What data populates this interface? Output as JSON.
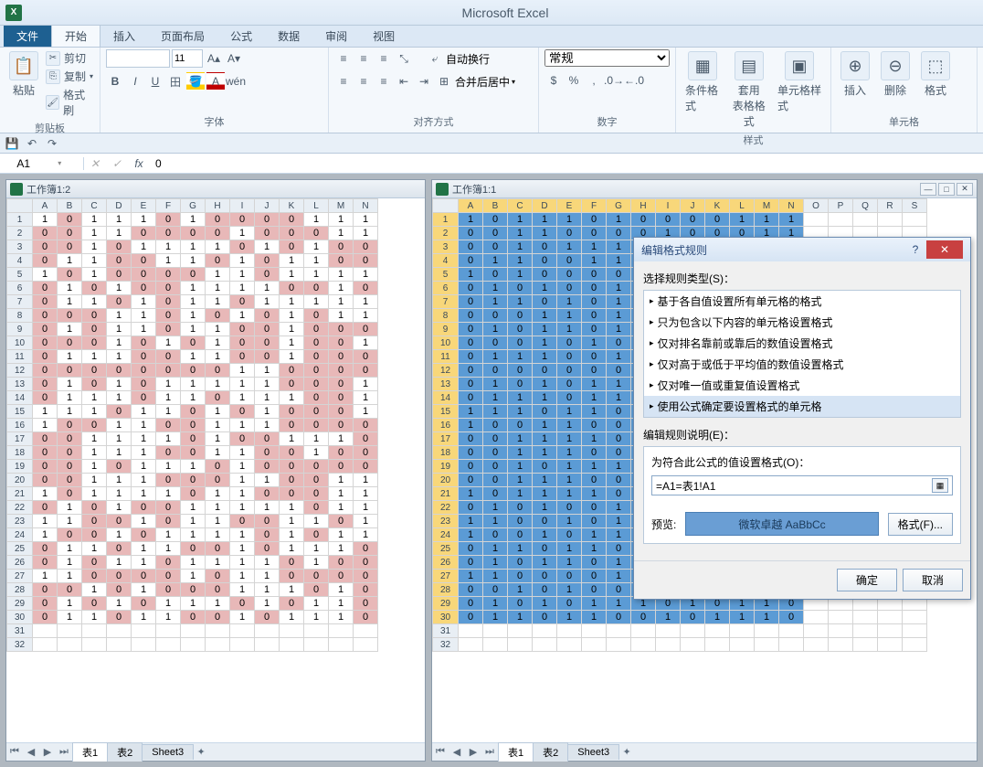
{
  "app": {
    "title": "Microsoft Excel",
    "icon_letter": "X"
  },
  "tabs": {
    "file": "文件",
    "home": "开始",
    "insert": "插入",
    "layout": "页面布局",
    "formulas": "公式",
    "data": "数据",
    "review": "审阅",
    "view": "视图"
  },
  "ribbon": {
    "clipboard": {
      "paste": "粘贴",
      "cut": "剪切",
      "copy": "复制",
      "brush": "格式刷",
      "label": "剪贴板"
    },
    "font": {
      "size": "11",
      "label": "字体"
    },
    "align": {
      "wrap": "自动换行",
      "merge": "合并后居中",
      "label": "对齐方式"
    },
    "number": {
      "general": "常规",
      "label": "数字"
    },
    "styles": {
      "cond": "条件格式",
      "table": "套用\n表格格式",
      "cell": "单元格样式",
      "label": "样式"
    },
    "cells": {
      "insert": "插入",
      "delete": "删除",
      "format": "格式",
      "label": "单元格"
    }
  },
  "namebox": "A1",
  "formula_value": "0",
  "left_win": {
    "title": "工作簿1:2"
  },
  "right_win": {
    "title": "工作簿1:1"
  },
  "columns": [
    "A",
    "B",
    "C",
    "D",
    "E",
    "F",
    "G",
    "H",
    "I",
    "J",
    "K",
    "L",
    "M",
    "N"
  ],
  "columns_r": [
    "A",
    "B",
    "C",
    "D",
    "E",
    "F",
    "G",
    "H",
    "I",
    "J",
    "K",
    "L",
    "M",
    "N",
    "O",
    "P",
    "Q",
    "R",
    "S"
  ],
  "grid_data": [
    [
      1,
      0,
      1,
      1,
      1,
      0,
      1,
      0,
      0,
      0,
      0,
      1,
      1,
      1
    ],
    [
      0,
      0,
      1,
      1,
      0,
      0,
      0,
      0,
      1,
      0,
      0,
      0,
      1,
      1
    ],
    [
      0,
      0,
      1,
      0,
      1,
      1,
      1,
      1,
      0,
      1,
      0,
      1,
      0,
      0
    ],
    [
      0,
      1,
      1,
      0,
      0,
      1,
      1,
      0,
      1,
      0,
      1,
      1,
      0,
      0
    ],
    [
      1,
      0,
      1,
      0,
      0,
      0,
      0,
      1,
      1,
      0,
      1,
      1,
      1,
      1
    ],
    [
      0,
      1,
      0,
      1,
      0,
      0,
      1,
      1,
      1,
      1,
      0,
      0,
      1,
      0
    ],
    [
      0,
      1,
      1,
      0,
      1,
      0,
      1,
      1,
      0,
      1,
      1,
      1,
      1,
      1
    ],
    [
      0,
      0,
      0,
      1,
      1,
      0,
      1,
      0,
      1,
      0,
      1,
      0,
      1,
      1
    ],
    [
      0,
      1,
      0,
      1,
      1,
      0,
      1,
      1,
      0,
      0,
      1,
      0,
      0,
      0
    ],
    [
      0,
      0,
      0,
      1,
      0,
      1,
      0,
      1,
      0,
      0,
      1,
      0,
      0,
      1
    ],
    [
      0,
      1,
      1,
      1,
      0,
      0,
      1,
      1,
      0,
      0,
      1,
      0,
      0,
      0
    ],
    [
      0,
      0,
      0,
      0,
      0,
      0,
      0,
      0,
      1,
      1,
      0,
      0,
      0,
      0
    ],
    [
      0,
      1,
      0,
      1,
      0,
      1,
      1,
      1,
      1,
      1,
      0,
      0,
      0,
      1
    ],
    [
      0,
      1,
      1,
      1,
      0,
      1,
      1,
      0,
      1,
      1,
      1,
      0,
      0,
      1
    ],
    [
      1,
      1,
      1,
      0,
      1,
      1,
      0,
      1,
      0,
      1,
      0,
      0,
      0,
      1
    ],
    [
      1,
      0,
      0,
      1,
      1,
      0,
      0,
      1,
      1,
      1,
      0,
      0,
      0,
      0
    ],
    [
      0,
      0,
      1,
      1,
      1,
      1,
      0,
      1,
      0,
      0,
      1,
      1,
      1,
      0
    ],
    [
      0,
      0,
      1,
      1,
      1,
      0,
      0,
      1,
      1,
      0,
      0,
      1,
      0,
      0
    ],
    [
      0,
      0,
      1,
      0,
      1,
      1,
      1,
      0,
      1,
      0,
      0,
      0,
      0,
      0
    ],
    [
      0,
      0,
      1,
      1,
      1,
      0,
      0,
      0,
      1,
      1,
      0,
      0,
      1,
      1
    ],
    [
      1,
      0,
      1,
      1,
      1,
      1,
      0,
      1,
      1,
      0,
      0,
      0,
      1,
      1
    ],
    [
      0,
      1,
      0,
      1,
      0,
      0,
      1,
      1,
      1,
      1,
      1,
      0,
      1,
      1
    ],
    [
      1,
      1,
      0,
      0,
      1,
      0,
      1,
      1,
      0,
      0,
      1,
      1,
      0,
      1
    ],
    [
      1,
      0,
      0,
      1,
      0,
      1,
      1,
      1,
      1,
      0,
      1,
      0,
      1,
      1
    ],
    [
      0,
      1,
      1,
      0,
      1,
      1,
      0,
      0,
      1,
      0,
      1,
      1,
      1,
      0
    ],
    [
      0,
      1,
      0,
      1,
      1,
      0,
      1,
      1,
      1,
      1,
      0,
      1,
      0,
      0
    ],
    [
      1,
      1,
      0,
      0,
      0,
      0,
      1,
      0,
      1,
      1,
      0,
      0,
      0,
      0
    ],
    [
      0,
      0,
      1,
      0,
      1,
      0,
      0,
      0,
      1,
      1,
      1,
      0,
      1,
      0
    ],
    [
      0,
      1,
      0,
      1,
      0,
      1,
      1,
      1,
      0,
      1,
      0,
      1,
      1,
      0
    ],
    [
      0,
      1,
      1,
      0,
      1,
      1,
      0,
      0,
      1,
      0,
      1,
      1,
      1,
      0
    ]
  ],
  "sheet_tabs": {
    "s1": "表1",
    "s2": "表2",
    "s3": "Sheet3"
  },
  "dialog": {
    "title": "编辑格式规则",
    "select_label": "选择规则类型(S)：",
    "rules": [
      "基于各自值设置所有单元格的格式",
      "只为包含以下内容的单元格设置格式",
      "仅对排名靠前或靠后的数值设置格式",
      "仅对高于或低于平均值的数值设置格式",
      "仅对唯一值或重复值设置格式",
      "使用公式确定要设置格式的单元格"
    ],
    "edit_label": "编辑规则说明(E)：",
    "formula_label": "为符合此公式的值设置格式(O)：",
    "formula_value": "=A1=表1!A1",
    "preview_label": "预览:",
    "preview_text": "微软卓越 AaBbCc",
    "format_btn": "格式(F)...",
    "ok": "确定",
    "cancel": "取消"
  }
}
